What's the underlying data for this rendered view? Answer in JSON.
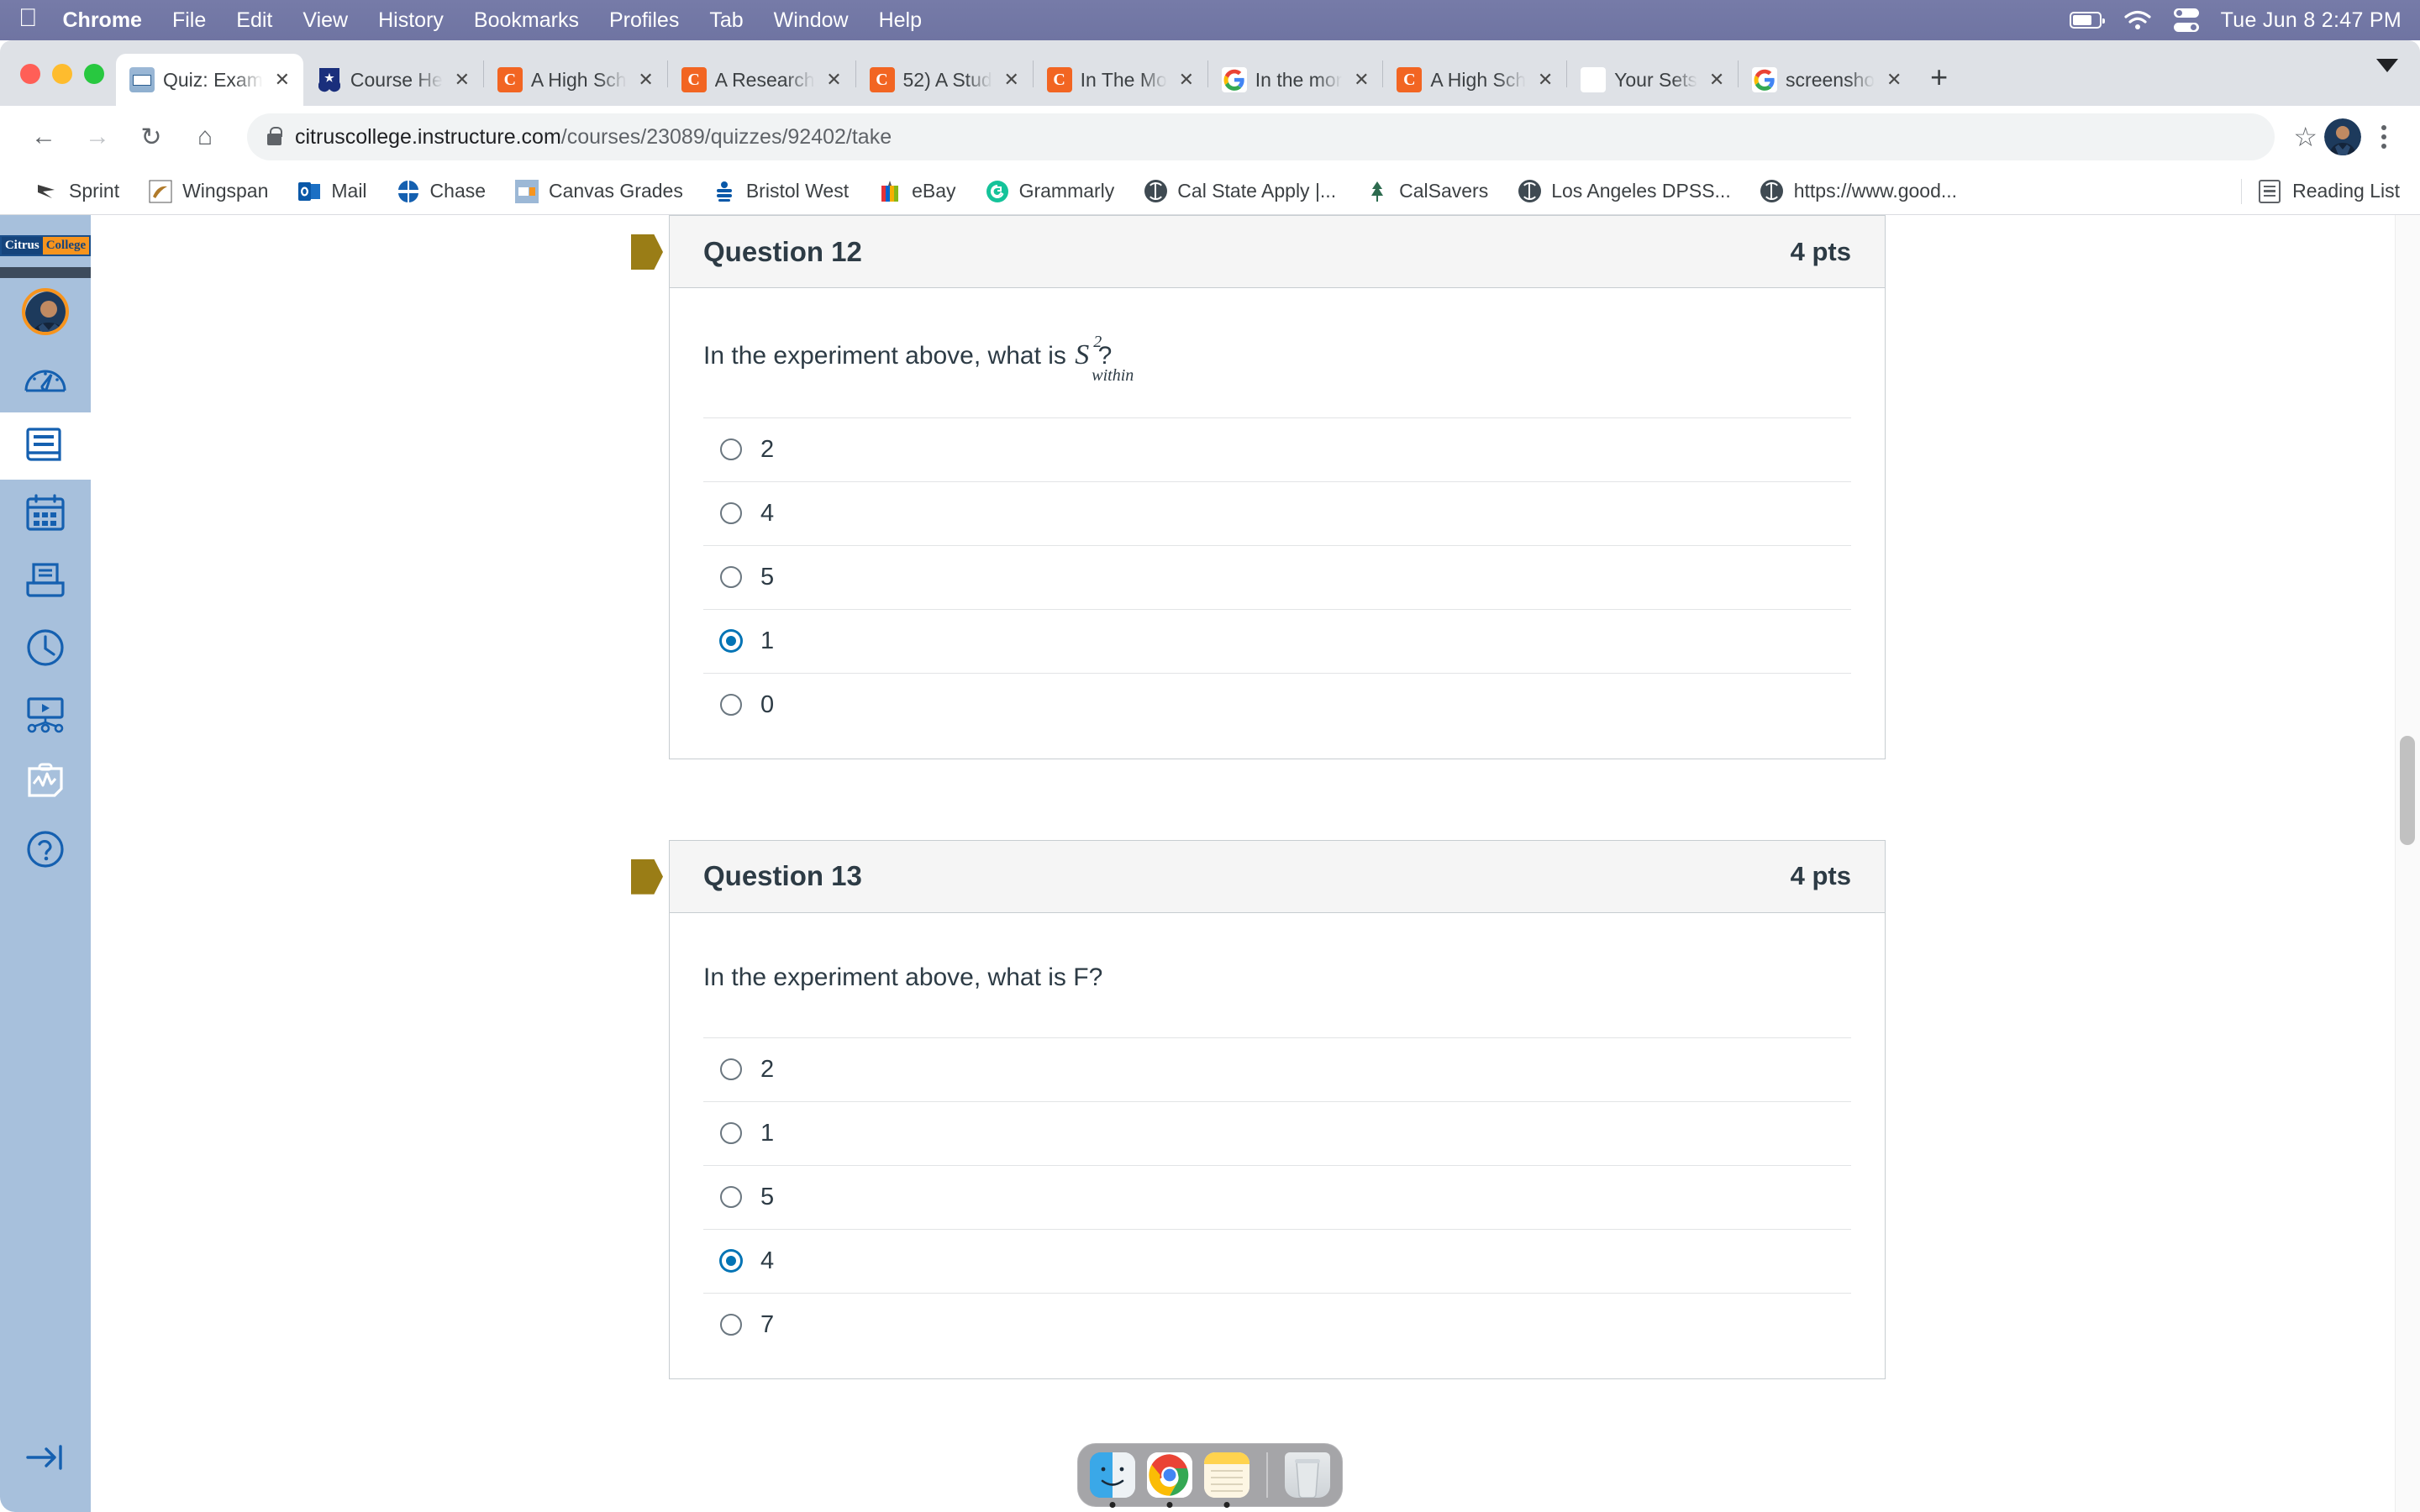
{
  "macos": {
    "apple_glyph": "●",
    "menus": [
      "Chrome",
      "File",
      "Edit",
      "View",
      "History",
      "Bookmarks",
      "Profiles",
      "Tab",
      "Window",
      "Help"
    ],
    "status_icons": [
      "battery-icon",
      "wifi-icon",
      "control-center-icon"
    ],
    "clock": "Tue Jun 8  2:47 PM"
  },
  "browser": {
    "tabs": [
      {
        "title": "Quiz: Exam",
        "favicon": "canvas-icon",
        "active": true
      },
      {
        "title": "Course He",
        "favicon": "shield-icon",
        "active": false
      },
      {
        "title": "A High Sch",
        "favicon": "chegg-icon",
        "active": false
      },
      {
        "title": "A Research",
        "favicon": "chegg-icon",
        "active": false
      },
      {
        "title": "52) A Stud",
        "favicon": "chegg-icon",
        "active": false
      },
      {
        "title": "In The Mo",
        "favicon": "chegg-icon",
        "active": false
      },
      {
        "title": "In the mor",
        "favicon": "google-icon",
        "active": false
      },
      {
        "title": "A High Sch",
        "favicon": "chegg-icon",
        "active": false
      },
      {
        "title": "Your Sets",
        "favicon": "quizlet-icon",
        "active": false
      },
      {
        "title": "screensho",
        "favicon": "google-icon",
        "active": false
      }
    ],
    "tab_close_label": "✕",
    "new_tab_label": "+",
    "nav": {
      "back": "←",
      "forward": "→",
      "reload": "↻",
      "home": "⌂"
    },
    "url": {
      "lock": "lock-icon",
      "domain": "citruscollege.instructure.com",
      "path": "/courses/23089/quizzes/92402/take"
    },
    "star_label": "☆",
    "bookmarks": [
      {
        "label": "Sprint",
        "icon": "sprint-icon"
      },
      {
        "label": "Wingspan",
        "icon": "wingspan-icon"
      },
      {
        "label": "Mail",
        "icon": "outlook-icon"
      },
      {
        "label": "Chase",
        "icon": "chase-icon"
      },
      {
        "label": "Canvas Grades",
        "icon": "canvas-icon"
      },
      {
        "label": "Bristol West",
        "icon": "bristol-icon"
      },
      {
        "label": "eBay",
        "icon": "ebay-icon"
      },
      {
        "label": "Grammarly",
        "icon": "grammarly-icon"
      },
      {
        "label": "Cal State Apply |...",
        "icon": "globe-icon"
      },
      {
        "label": "CalSavers",
        "icon": "tree-icon"
      },
      {
        "label": "Los Angeles DPSS...",
        "icon": "globe-icon"
      },
      {
        "label": "https://www.good...",
        "icon": "globe-icon"
      }
    ],
    "reading_list": "Reading List"
  },
  "canvas_nav": {
    "logo": {
      "left": "Citrus",
      "right": "College"
    },
    "items": [
      {
        "name": "account",
        "icon": "avatar-icon",
        "active": false
      },
      {
        "name": "dashboard",
        "icon": "dashboard-icon",
        "active": false
      },
      {
        "name": "courses",
        "icon": "courses-icon",
        "active": true
      },
      {
        "name": "calendar",
        "icon": "calendar-icon",
        "active": false
      },
      {
        "name": "inbox",
        "icon": "inbox-icon",
        "active": false
      },
      {
        "name": "history",
        "icon": "clock-icon",
        "active": false
      },
      {
        "name": "studio",
        "icon": "studio-icon",
        "active": false
      },
      {
        "name": "commons",
        "icon": "chart-clipboard-icon",
        "active": false
      },
      {
        "name": "help",
        "icon": "help-icon",
        "active": false
      }
    ],
    "collapse_label": "→|"
  },
  "quiz": {
    "questions": [
      {
        "name": "Question 12",
        "points": "4 pts",
        "text_before": "In the experiment above, what is",
        "math": {
          "base": "S",
          "sup": "2",
          "sub": "within"
        },
        "text_after": "?",
        "options": [
          {
            "label": "2",
            "selected": false
          },
          {
            "label": "4",
            "selected": false
          },
          {
            "label": "5",
            "selected": false
          },
          {
            "label": "1",
            "selected": true
          },
          {
            "label": "0",
            "selected": false
          }
        ]
      },
      {
        "name": "Question 13",
        "points": "4 pts",
        "text_before": "In the experiment above, what is F?",
        "math": null,
        "text_after": "",
        "options": [
          {
            "label": "2",
            "selected": false
          },
          {
            "label": "1",
            "selected": false
          },
          {
            "label": "5",
            "selected": false
          },
          {
            "label": "4",
            "selected": true
          },
          {
            "label": "7",
            "selected": false
          }
        ]
      }
    ]
  },
  "dock": {
    "items": [
      "finder-icon",
      "chrome-icon",
      "notes-icon"
    ],
    "trash": "trash-icon"
  },
  "colors": {
    "canvas_blue": "#0374b5",
    "flag_gold": "#9a7d16",
    "menubar": "#6f74a2",
    "nav_blue": "#a7c0dc"
  }
}
